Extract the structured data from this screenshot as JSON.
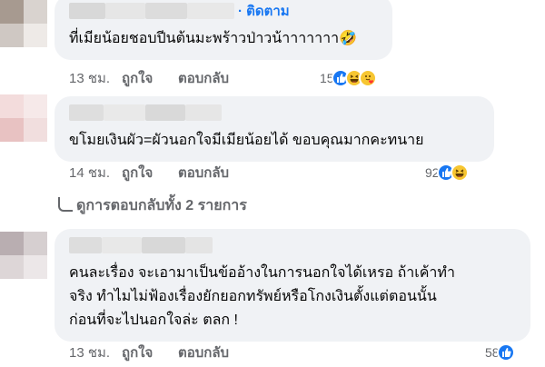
{
  "comments": [
    {
      "follow_label": "· ติดตาม",
      "text": "ที่เมียน้อยชอบปีนต้นมะพร้าวป่าวน้าาาาาาา🤣",
      "time": "13 ชม.",
      "like_label": "ถูกใจ",
      "reply_label": "ตอบกลับ",
      "reaction_count": "15",
      "reactions": [
        "like-icon",
        "haha-icon",
        "care-icon"
      ]
    },
    {
      "text": "ขโมยเงินผัว=ผัวนอกใจมีเมียน้อยได้ ขอบคุณมากคะทนาย",
      "time": "14 ชม.",
      "like_label": "ถูกใจ",
      "reply_label": "ตอบกลับ",
      "reaction_count": "92",
      "reactions": [
        "like-icon",
        "haha-icon"
      ]
    },
    {
      "text_lines": [
        "คนละเรื่อง จะเอามาเป็นข้ออ้างในการนอกใจได้เหรอ ถ้าเค้าทำ",
        "จริง ทำไมไม่ฟ้องเรื่องยักยอกทรัพย์หรือโกงเงินตั้งแต่ตอนนั้น",
        "ก่อนที่จะไปนอกใจล่ะ ตลก !"
      ],
      "time": "13 ชม.",
      "like_label": "ถูกใจ",
      "reply_label": "ตอบกลับ",
      "reaction_count": "58",
      "reactions": [
        "like-icon"
      ]
    }
  ],
  "view_replies_label": "ดูการตอบกลับทั้ง 2 รายการ",
  "colors": {
    "bubble": "#f0f2f5",
    "accent": "#1877f2",
    "meta": "#65676b"
  }
}
